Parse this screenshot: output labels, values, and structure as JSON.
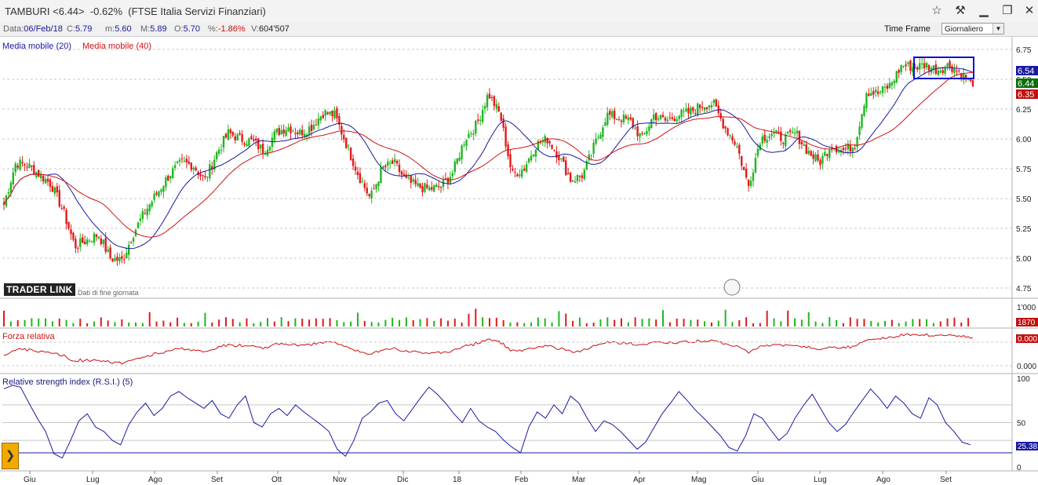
{
  "window": {
    "title": "TAMBURI <6.44>  -0.62%  (FTSE Italia Servizi Finanziari)",
    "icons": [
      "star-icon",
      "pin-icon",
      "minimize-icon",
      "restore-icon",
      "close-icon"
    ]
  },
  "info": {
    "date_k": "Data:",
    "date_v": "06/Feb/18",
    "c_k": "C:",
    "c_v": "5.79",
    "m_k": "m:",
    "m_v": "5.60",
    "M_k": "M:",
    "M_v": "5.89",
    "o_k": "O:",
    "o_v": "5.70",
    "pct_k": "%:",
    "pct_v": "-1.86%",
    "vol_k": "V:",
    "vol_v": "604'507"
  },
  "timeframe": {
    "label": "Time Frame",
    "value": "Giornaliero"
  },
  "legend": {
    "ma20": "Media mobile (20)",
    "ma40": "Media mobile (40)"
  },
  "logo": {
    "text": "TRADER LINK",
    "sub": "Dati di fine giornata"
  },
  "panels": {
    "forza_title": "Forza relativa",
    "rsi_title": "Relative strength index (R.S.I.) (5)"
  },
  "colors": {
    "ma20": "#1a1aa0",
    "ma40": "#d01414",
    "up": "#1fb71f",
    "down": "#e21a1a",
    "rsi": "#1a1aa0",
    "forza": "#cc1010",
    "grid": "#c8c8c8"
  },
  "chart_data": {
    "type": "candlestick",
    "symbol": "TAMBURI",
    "last": 6.44,
    "ylim": [
      4.75,
      6.75
    ],
    "y_ticks": [
      "6.75",
      "6.50",
      "6.25",
      "6.00",
      "5.75",
      "5.50",
      "5.25",
      "5.00",
      "4.75"
    ],
    "x_ticks": [
      "Giu",
      "Lug",
      "Ago",
      "Set",
      "Ott",
      "Nov",
      "Dic",
      "18",
      "Feb",
      "Mar",
      "Apr",
      "Mag",
      "Giu",
      "Lug",
      "Ago",
      "Set"
    ],
    "price_labels": {
      "ma20": "6.54",
      "last": "6.44",
      "ma40": "6.35"
    },
    "close_anchors": [
      5.45,
      5.8,
      5.78,
      5.7,
      5.62,
      5.4,
      5.1,
      5.15,
      5.2,
      5.0,
      4.98,
      5.22,
      5.4,
      5.55,
      5.7,
      5.8,
      5.78,
      5.65,
      5.88,
      6.05,
      6.0,
      5.98,
      5.9,
      6.05,
      6.1,
      6.05,
      6.1,
      6.22,
      6.2,
      5.95,
      5.7,
      5.5,
      5.75,
      5.8,
      5.65,
      5.6,
      5.58,
      5.6,
      5.72,
      6.0,
      6.12,
      6.38,
      6.2,
      5.7,
      5.75,
      5.95,
      6.0,
      5.85,
      5.65,
      5.7,
      5.95,
      6.2,
      6.18,
      6.15,
      6.0,
      6.2,
      6.15,
      6.2,
      6.22,
      6.28,
      6.3,
      6.1,
      5.95,
      5.6,
      6.0,
      6.05,
      6.0,
      6.05,
      5.9,
      5.8,
      5.95,
      5.9,
      5.95,
      6.4,
      6.38,
      6.45,
      6.62,
      6.6,
      6.62,
      6.58,
      6.62,
      6.55,
      6.44
    ],
    "ma20_labels": "Media mobile (20)",
    "ma40_labels": "Media mobile (40)",
    "volume": {
      "tick": "1'000",
      "label": "1870"
    },
    "forza_relativa": {
      "ticks": [
        "0.000",
        "0.000"
      ],
      "label": "0.000"
    },
    "rsi": {
      "ticks": [
        "100",
        "50",
        "0"
      ],
      "label": "25.38",
      "values": [
        88,
        92,
        90,
        72,
        55,
        40,
        15,
        10,
        30,
        52,
        60,
        45,
        40,
        30,
        25,
        48,
        62,
        72,
        58,
        66,
        80,
        85,
        78,
        72,
        66,
        75,
        60,
        55,
        70,
        80,
        50,
        45,
        60,
        66,
        58,
        70,
        62,
        55,
        48,
        40,
        20,
        12,
        30,
        55,
        62,
        72,
        75,
        60,
        52,
        65,
        78,
        90,
        82,
        72,
        60,
        50,
        66,
        52,
        45,
        40,
        30,
        22,
        16,
        45,
        62,
        55,
        70,
        60,
        80,
        72,
        55,
        40,
        52,
        48,
        40,
        30,
        20,
        28,
        44,
        60,
        72,
        85,
        75,
        64,
        55,
        45,
        35,
        22,
        18,
        35,
        60,
        55,
        42,
        30,
        38,
        56,
        70,
        82,
        66,
        50,
        40,
        48,
        62,
        75,
        88,
        78,
        66,
        80,
        72,
        60,
        55,
        78,
        70,
        50,
        40,
        28,
        25
      ]
    }
  }
}
